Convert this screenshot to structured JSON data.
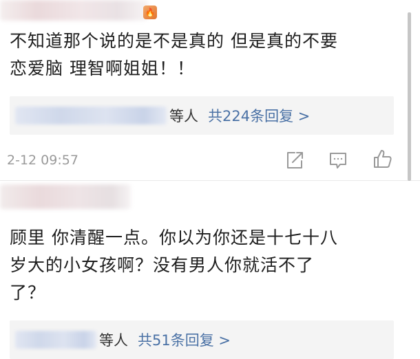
{
  "comments": [
    {
      "text_line1": "不知道那个说的是不是真的 但是真的不要",
      "text_line2": "恋爱脑  理智啊姐姐！！",
      "replies": {
        "suffix": "等人",
        "link_text": "共224条回复 >"
      },
      "timestamp": "2-12 09:57",
      "badge_icon": "fire-badge-icon"
    },
    {
      "text_line1": "顾里 你清醒一点。你以为你还是十七十八",
      "text_line2": "岁大的小女孩啊？没有男人你就活不了",
      "text_line3": "了？",
      "replies": {
        "suffix": "等人",
        "link_text": "共51条回复 >"
      }
    }
  ],
  "icons": [
    "share-icon",
    "comment-icon",
    "like-icon"
  ],
  "colors": {
    "link": "#4a71a5",
    "reply_bg": "#f4f4f4",
    "timestamp": "#9a9a9a",
    "text": "#1d1d1d"
  }
}
